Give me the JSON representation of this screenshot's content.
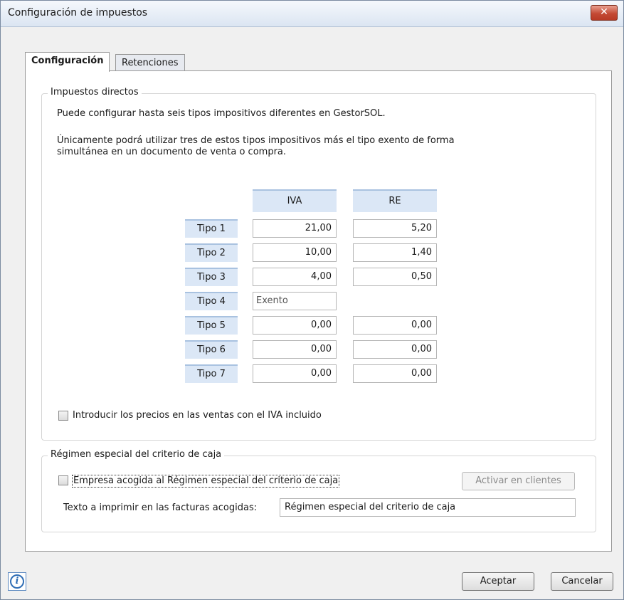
{
  "window": {
    "title": "Configuración de impuestos",
    "close_label": "✕"
  },
  "tabs": [
    {
      "label": "Configuración",
      "active": true
    },
    {
      "label": "Retenciones",
      "active": false
    }
  ],
  "direct_taxes": {
    "legend": "Impuestos directos",
    "info_line1": "Puede configurar hasta seis tipos impositivos diferentes en GestorSOL.",
    "info_line2a": "Únicamente podrá utilizar tres de estos tipos impositivos más el tipo exento de forma",
    "info_line2b": "simultánea en un documento de venta o compra.",
    "columns": {
      "iva": "IVA",
      "re": "RE"
    },
    "rows": [
      {
        "label": "Tipo 1",
        "iva": "21,00",
        "re": "5,20"
      },
      {
        "label": "Tipo 2",
        "iva": "10,00",
        "re": "1,40"
      },
      {
        "label": "Tipo 3",
        "iva": "4,00",
        "re": "0,50"
      },
      {
        "label": "Tipo 4",
        "iva": "Exento",
        "re": null
      },
      {
        "label": "Tipo 5",
        "iva": "0,00",
        "re": "0,00"
      },
      {
        "label": "Tipo 6",
        "iva": "0,00",
        "re": "0,00"
      },
      {
        "label": "Tipo 7",
        "iva": "0,00",
        "re": "0,00"
      }
    ],
    "include_vat_label": "Introducir los precios en las ventas con el IVA incluido",
    "include_vat_checked": false
  },
  "cash_regime": {
    "legend": "Régimen especial del criterio de caja",
    "checkbox_label": "Empresa acogida al Régimen especial del criterio de caja",
    "checkbox_checked": false,
    "activate_button": "Activar en clientes",
    "print_text_label": "Texto a imprimir en las facturas acogidas:",
    "print_text_value": "Régimen especial del criterio de caja"
  },
  "footer": {
    "accept": "Aceptar",
    "cancel": "Cancelar"
  },
  "colors": {
    "accent": "#dbe7f6",
    "close": "#c44a35"
  },
  "icons": {
    "info": "info-icon",
    "close": "close-icon"
  }
}
